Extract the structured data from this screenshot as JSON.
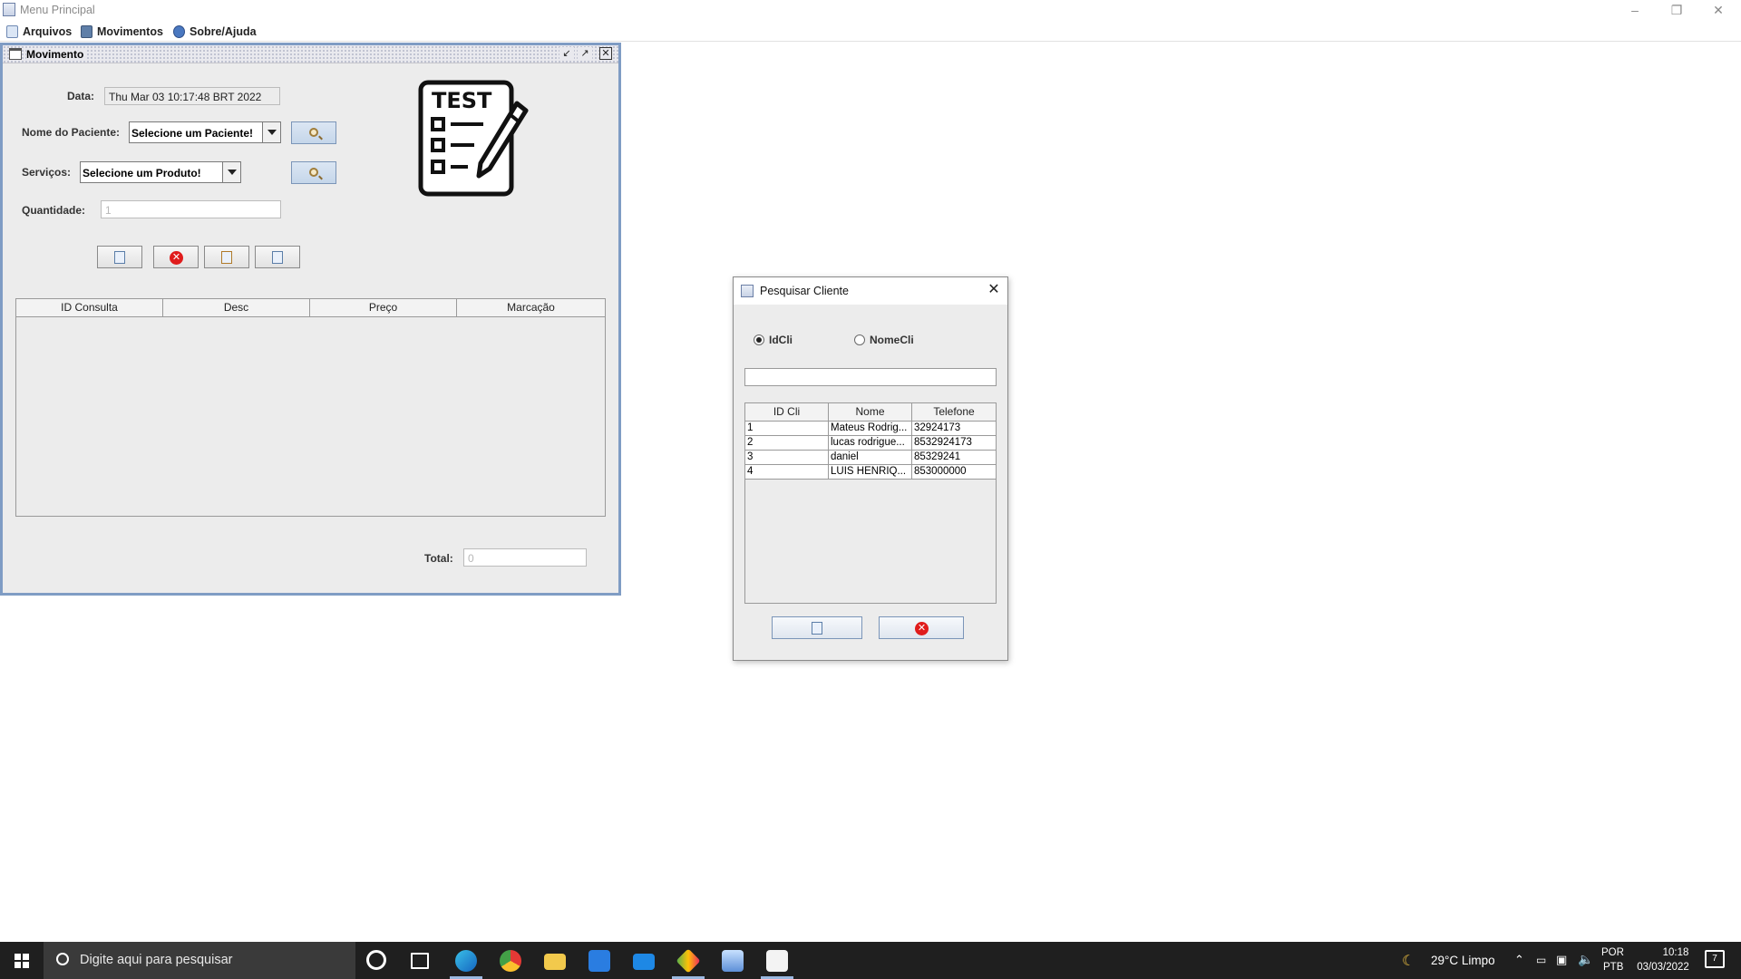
{
  "window": {
    "title": "Menu Principal"
  },
  "menu": {
    "items": [
      {
        "label": "Arquivos",
        "icon": "document-icon"
      },
      {
        "label": "Movimentos",
        "icon": "book-icon"
      },
      {
        "label": "Sobre/Ajuda",
        "icon": "info-icon"
      }
    ]
  },
  "movimento": {
    "title": "Movimento",
    "data_label": "Data:",
    "data_value": "Thu Mar 03 10:17:48 BRT 2022",
    "paciente_label": "Nome do Paciente:",
    "paciente_value": "Selecione um Paciente!",
    "servicos_label": "Serviços:",
    "servicos_value": "Selecione um Produto!",
    "quantidade_label": "Quantidade:",
    "quantidade_value": "1",
    "logo_text": "TEST",
    "table_headers": [
      "ID Consulta",
      "Desc",
      "Preço",
      "Marcação"
    ],
    "total_label": "Total:",
    "total_value": "0"
  },
  "dialog": {
    "title": "Pesquisar Cliente",
    "radio_idcli": "IdCli",
    "radio_nomecli": "NomeCli",
    "selected_radio": "IdCli",
    "search_value": "",
    "table_headers": [
      "ID Cli",
      "Nome",
      "Telefone"
    ],
    "rows": [
      {
        "id": "1",
        "nome": "Mateus Rodrig...",
        "telefone": "32924173"
      },
      {
        "id": "2",
        "nome": "lucas rodrigue...",
        "telefone": "8532924173"
      },
      {
        "id": "3",
        "nome": "daniel",
        "telefone": "85329241"
      },
      {
        "id": "4",
        "nome": "LUIS HENRIQ...",
        "telefone": "853000000"
      }
    ]
  },
  "taskbar": {
    "search_placeholder": "Digite aqui para pesquisar",
    "weather": "29°C  Limpo",
    "lang_top": "POR",
    "lang_bottom": "PTB",
    "time": "10:18",
    "date": "03/03/2022",
    "notifications": "7"
  },
  "colors": {
    "frame_border": "#7f9cc4",
    "panel_bg": "#ececec",
    "taskbar_bg": "#1f1f1f",
    "close_red": "#e01c1c"
  }
}
